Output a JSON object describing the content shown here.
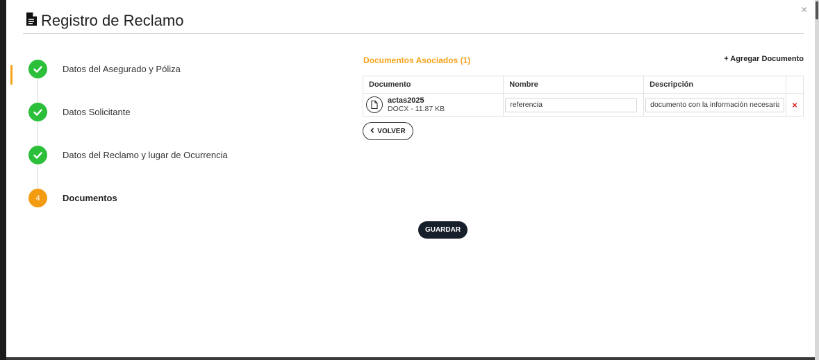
{
  "modal": {
    "title": "Registro de Reclamo",
    "close_label": "×"
  },
  "steps": [
    {
      "label": "Datos del Asegurado y Póliza",
      "status": "done"
    },
    {
      "label": "Datos Solicitante",
      "status": "done"
    },
    {
      "label": "Datos del Reclamo y lugar de Ocurrencia",
      "status": "done"
    },
    {
      "label": "Documentos",
      "status": "active",
      "number": "4"
    }
  ],
  "documents": {
    "title": "Documentos Asociados (1)",
    "add_label": "+ Agregar Documento",
    "columns": [
      "Documento",
      "Nombre",
      "Descripción"
    ],
    "rows": [
      {
        "file_name": "actas2025",
        "file_info": "DOCX - 11.87 KB",
        "nombre_value": "referencia",
        "descripcion_value": "documento con la información necesaria",
        "delete_label": "×"
      }
    ]
  },
  "buttons": {
    "volver": "VOLVER",
    "guardar": "GUARDAR"
  },
  "colors": {
    "accent": "#f5a31a",
    "success": "#2bbf3a",
    "step_active": "#f39c12",
    "primary_button": "#17202a",
    "danger": "#e02020"
  },
  "icons": {
    "title": "file-icon",
    "step_done": "check-icon",
    "document": "document-icon",
    "back": "chevron-left-icon"
  }
}
